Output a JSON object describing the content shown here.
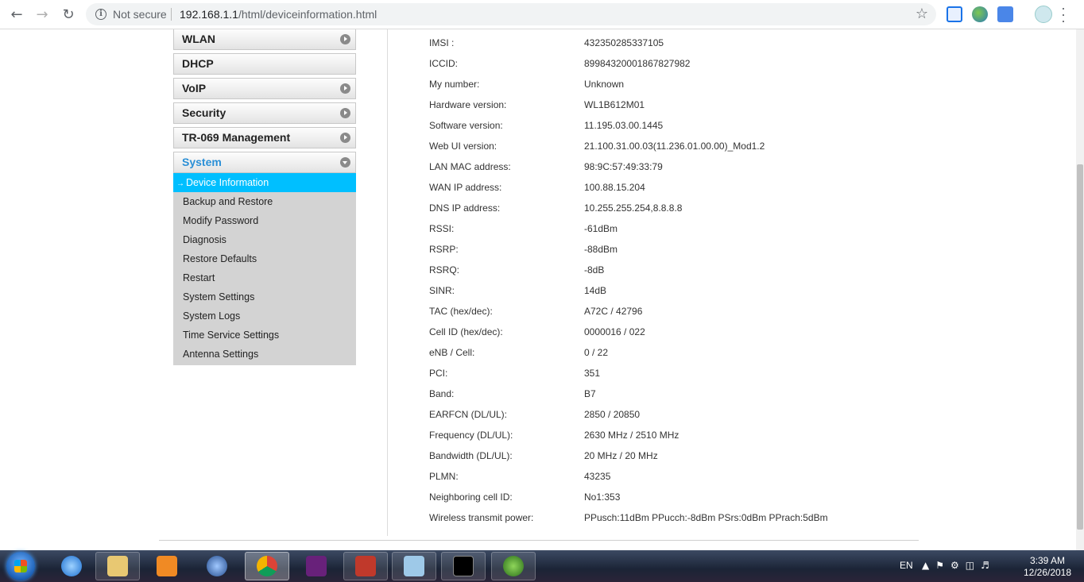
{
  "browser": {
    "security_label": "Not secure",
    "url_host": "192.168.1.1",
    "url_path": "/html/deviceinformation.html"
  },
  "sidebar": {
    "menus": [
      {
        "label": "WLAN"
      },
      {
        "label": "DHCP"
      },
      {
        "label": "VoIP"
      },
      {
        "label": "Security"
      },
      {
        "label": "TR-069 Management"
      },
      {
        "label": "System"
      }
    ],
    "system_items": [
      {
        "label": "Device Information",
        "active": true
      },
      {
        "label": "Backup and Restore"
      },
      {
        "label": "Modify Password"
      },
      {
        "label": "Diagnosis"
      },
      {
        "label": "Restore Defaults"
      },
      {
        "label": "Restart"
      },
      {
        "label": "System Settings"
      },
      {
        "label": "System Logs"
      },
      {
        "label": "Time Service Settings"
      },
      {
        "label": "Antenna Settings"
      }
    ]
  },
  "device_info": [
    {
      "label": "IMSI :",
      "value": "432350285337105"
    },
    {
      "label": "ICCID:",
      "value": "89984320001867827982"
    },
    {
      "label": "My number:",
      "value": "Unknown"
    },
    {
      "label": "Hardware version:",
      "value": "WL1B612M01"
    },
    {
      "label": "Software version:",
      "value": "11.195.03.00.1445"
    },
    {
      "label": "Web UI version:",
      "value": "21.100.31.00.03(11.236.01.00.00)_Mod1.2"
    },
    {
      "label": "LAN MAC address:",
      "value": "98:9C:57:49:33:79"
    },
    {
      "label": "WAN IP address:",
      "value": "100.88.15.204"
    },
    {
      "label": "DNS IP address:",
      "value": "10.255.255.254,8.8.8.8"
    },
    {
      "label": "RSSI:",
      "value": "-61dBm"
    },
    {
      "label": "RSRP:",
      "value": "-88dBm"
    },
    {
      "label": "RSRQ:",
      "value": "-8dB"
    },
    {
      "label": "SINR:",
      "value": "14dB"
    },
    {
      "label": "TAC (hex/dec):",
      "value": "A72C / 42796"
    },
    {
      "label": "Cell ID (hex/dec):",
      "value": "0000016 / 022"
    },
    {
      "label": "eNB / Cell:",
      "value": "0 / 22"
    },
    {
      "label": "PCI:",
      "value": "351"
    },
    {
      "label": "Band:",
      "value": "B7"
    },
    {
      "label": "EARFCN (DL/UL):",
      "value": "2850 / 20850"
    },
    {
      "label": "Frequency (DL/UL):",
      "value": "2630 MHz / 2510 MHz"
    },
    {
      "label": "Bandwidth (DL/UL):",
      "value": "20 MHz / 20 MHz"
    },
    {
      "label": "PLMN:",
      "value": "43235"
    },
    {
      "label": "Neighboring cell ID:",
      "value": "No1:353"
    },
    {
      "label": "Wireless transmit power:",
      "value": "PPusch:11dBm PPucch:-8dBm PSrs:0dBm PPrach:5dBm"
    }
  ],
  "taskbar": {
    "language": "EN",
    "time": "3:39 AM",
    "date": "12/26/2018"
  },
  "icons": {
    "back": "back-arrow-icon",
    "forward": "forward-arrow-icon",
    "reload": "reload-icon",
    "info": "info-icon",
    "star": "star-icon",
    "menu": "kebab-menu-icon"
  }
}
